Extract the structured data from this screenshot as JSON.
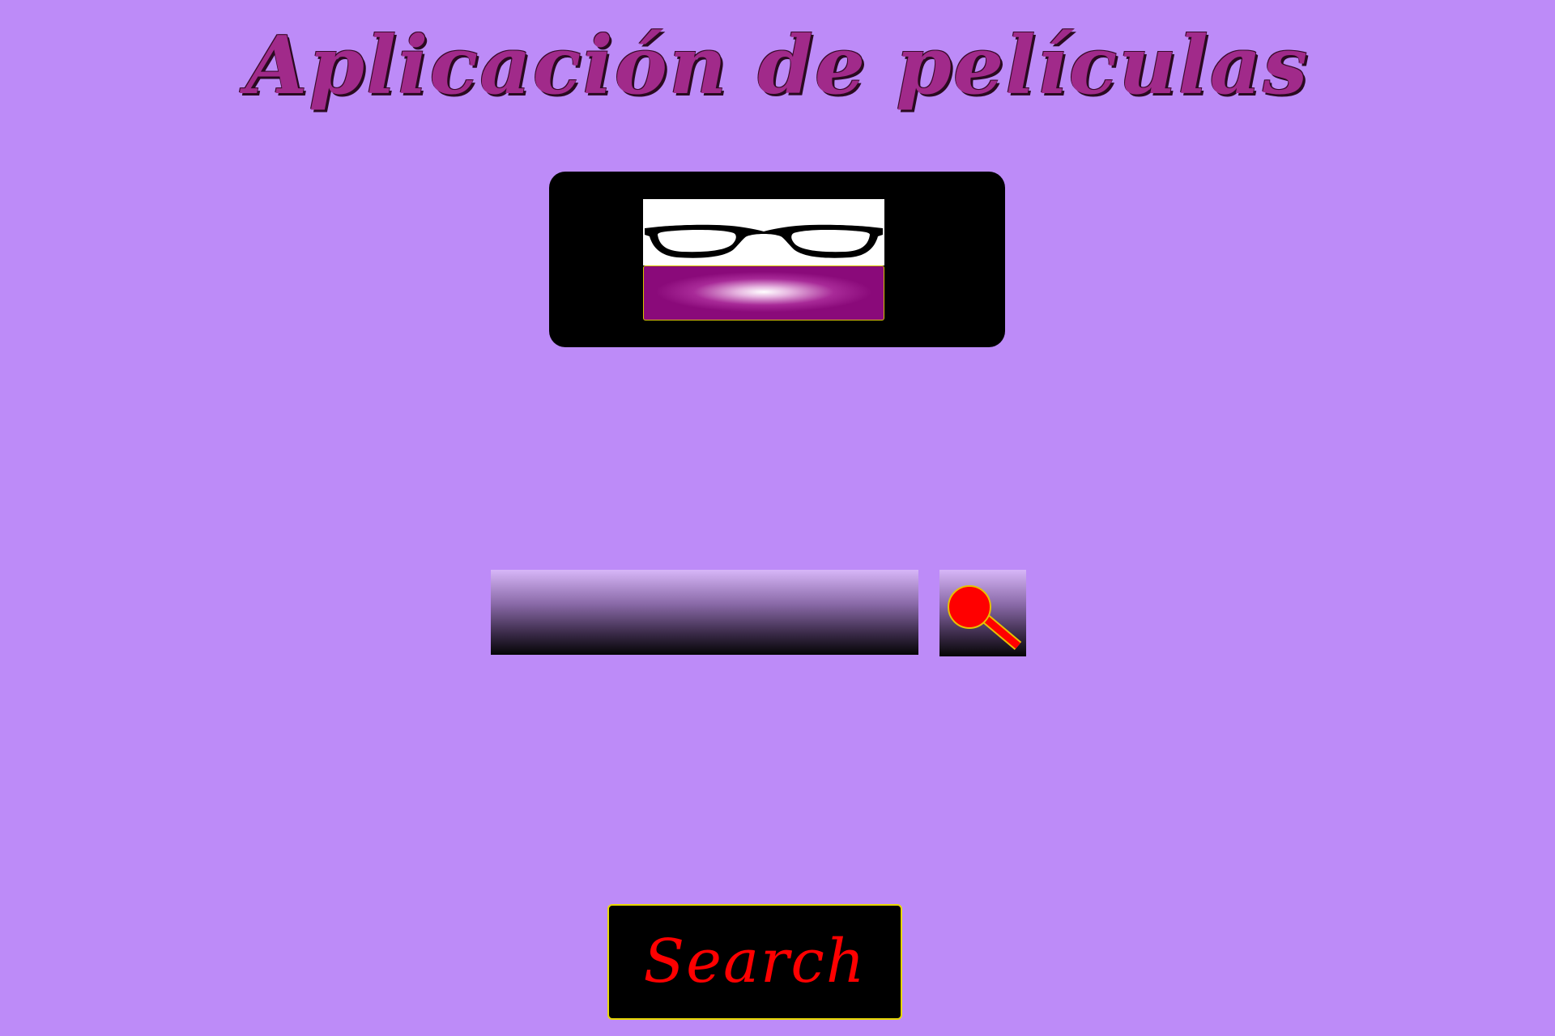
{
  "app": {
    "title": "Aplicación de películas"
  },
  "logo": {
    "icon": "glasses-icon"
  },
  "search": {
    "input_value": "",
    "placeholder": "",
    "icon_button": "magnifier-icon",
    "button_label": "Search"
  },
  "colors": {
    "background": "#bd8bf8",
    "title": "#a12a8a",
    "button_text": "#ff0000",
    "button_border": "#e8d800",
    "logo_accent": "#8a0a7a"
  }
}
